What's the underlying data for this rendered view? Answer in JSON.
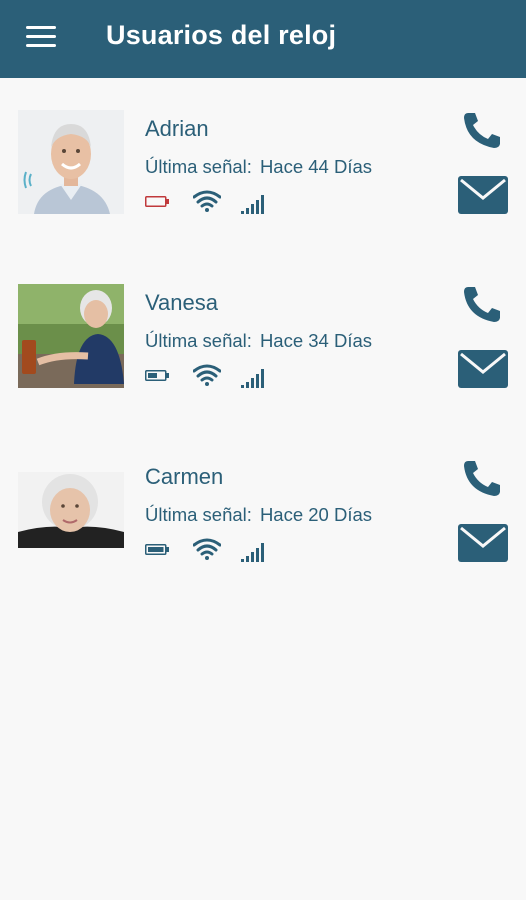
{
  "app": {
    "title": "Usuarios del reloj",
    "accent": "#2b5f78"
  },
  "users": [
    {
      "name": "Adrian",
      "signal_label": "Última señal:",
      "signal_value": "Hace 44 Días",
      "battery_state": "low",
      "battery_color": "#c0393b"
    },
    {
      "name": "Vanesa",
      "signal_label": "Última señal:",
      "signal_value": "Hace 34 Días",
      "battery_state": "half",
      "battery_color": "#2b5f78"
    },
    {
      "name": "Carmen",
      "signal_label": "Última señal:",
      "signal_value": "Hace 20 Días",
      "battery_state": "full",
      "battery_color": "#2b5f78"
    }
  ],
  "icons": {
    "menu": "hamburger-menu-icon",
    "call": "phone-icon",
    "mail": "envelope-icon",
    "battery": "battery-icon",
    "wifi": "wifi-icon",
    "cell": "cell-signal-icon"
  }
}
